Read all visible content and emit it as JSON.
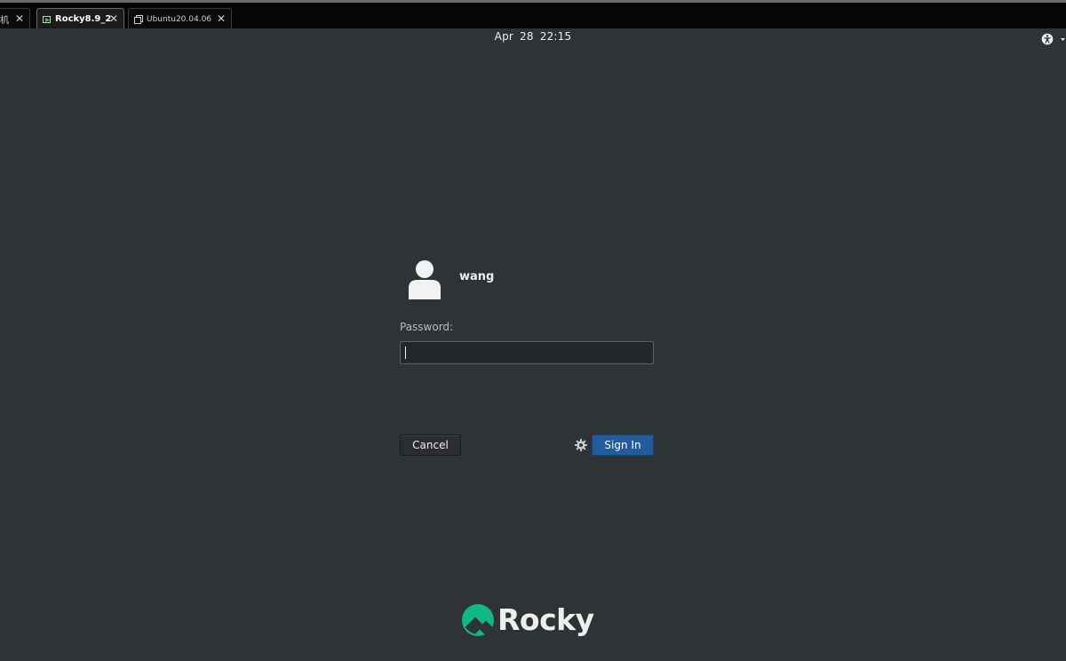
{
  "tabs": [
    {
      "label": "机",
      "active": false
    },
    {
      "label": "Rocky8.9_2",
      "active": true
    },
    {
      "label": "Ubuntu20.04.06",
      "active": false
    }
  ],
  "topbar": {
    "clock": "Apr 28  22:15"
  },
  "login": {
    "username": "wang",
    "password_label": "Password:",
    "password_value": "",
    "cancel_label": "Cancel",
    "signin_label": "Sign In"
  },
  "branding": {
    "logo_text": "Rocky"
  },
  "colors": {
    "background": "#2e3436",
    "accent": "#215d9c",
    "brand_green": "#10b981"
  },
  "icons": [
    "accessibility-icon",
    "chevron-down-icon",
    "avatar-icon",
    "gear-icon",
    "rocky-logo-icon",
    "vm-icon",
    "close-icon"
  ]
}
